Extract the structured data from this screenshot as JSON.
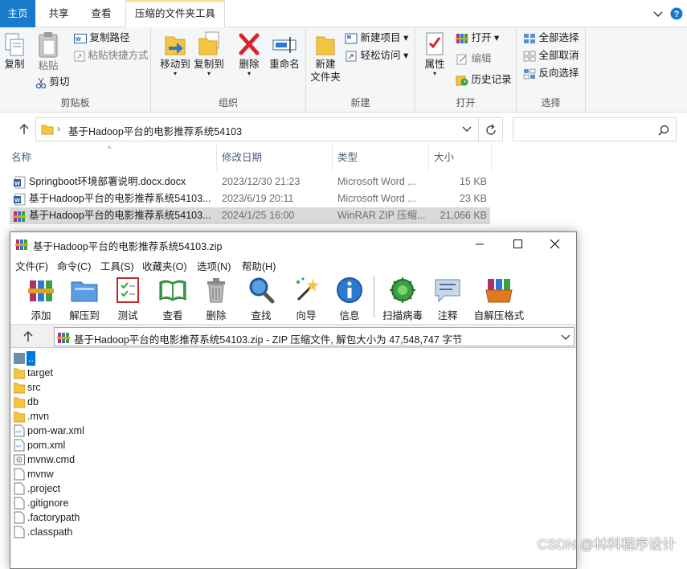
{
  "ribbon": {
    "tabs": [
      "主页",
      "共享",
      "查看",
      "压缩的文件夹工具"
    ],
    "clipboard": {
      "copy": "复制",
      "paste": "粘贴",
      "copy_path": "复制路径",
      "paste_shortcut": "粘贴快捷方式",
      "cut": "剪切",
      "label": "剪贴板"
    },
    "organize": {
      "move_to": "移动到",
      "copy_to": "复制到",
      "delete": "删除",
      "rename": "重命名",
      "label": "组织"
    },
    "new": {
      "new_folder_line1": "新建",
      "new_folder_line2": "文件夹",
      "new_item": "新建项目",
      "easy_access": "轻松访问",
      "label": "新建"
    },
    "open": {
      "properties": "属性",
      "open": "打开",
      "edit": "编辑",
      "history": "历史记录",
      "label": "打开"
    },
    "select": {
      "select_all": "全部选择",
      "select_none": "全部取消",
      "invert": "反向选择",
      "label": "选择"
    }
  },
  "address": {
    "path": "基于Hadoop平台的电影推荐系统54103"
  },
  "file_list": {
    "headers": {
      "name": "名称",
      "date": "修改日期",
      "type": "类型",
      "size": "大小"
    },
    "rows": [
      {
        "name": "Springboot环境部署说明.docx.docx",
        "date": "2023/12/30 21:23",
        "type": "Microsoft Word ...",
        "size": "15 KB"
      },
      {
        "name": "基于Hadoop平台的电影推荐系统54103...",
        "date": "2023/6/19 20:11",
        "type": "Microsoft Word ...",
        "size": "23 KB"
      },
      {
        "name": "基于Hadoop平台的电影推荐系统54103...",
        "date": "2024/1/25 16:00",
        "type": "WinRAR ZIP 压缩...",
        "size": "21,066 KB"
      }
    ]
  },
  "rar": {
    "title": "基于Hadoop平台的电影推荐系统54103.zip",
    "menu": [
      "文件(F)",
      "命令(C)",
      "工具(S)",
      "收藏夹(O)",
      "选项(N)",
      "帮助(H)"
    ],
    "toolbar": [
      "添加",
      "解压到",
      "测试",
      "查看",
      "删除",
      "查找",
      "向导",
      "信息",
      "扫描病毒",
      "注释",
      "自解压格式"
    ],
    "path": "基于Hadoop平台的电影推荐系统54103.zip - ZIP 压缩文件, 解包大小为 47,548,747 字节",
    "items": [
      "..",
      "target",
      "src",
      "db",
      ".mvn",
      "pom-war.xml",
      "pom.xml",
      "mvnw.cmd",
      "mvnw",
      ".project",
      ".gitignore",
      ".factorypath",
      ".classpath"
    ]
  },
  "watermark": "CSDN @林科程序设计",
  "colors": {
    "accent": "#1979ca",
    "selected_row": "#d9d9d9",
    "folder": "#f5c542"
  }
}
